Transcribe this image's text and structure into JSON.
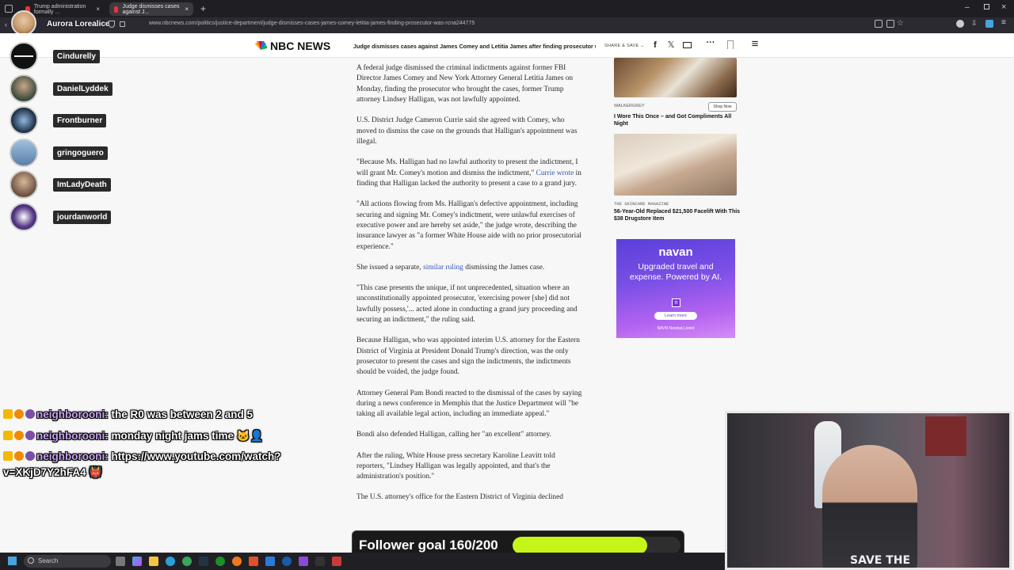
{
  "browser": {
    "tabs": [
      {
        "label": "Trump administration formally ...",
        "active": false
      },
      {
        "label": "Judge dismisses cases against J...",
        "active": true
      }
    ],
    "profile_name": "Aurora Lorealice",
    "url": "www.nbcnews.com/politics/justice-department/judge-dismisses-cases-james-comey-letitia-james-finding-prosecutor-was-rcna244775"
  },
  "site": {
    "brand": "NBC NEWS",
    "headline": "Judge dismisses cases against James Comey and Letitia James after finding prosecutor was un",
    "share_save": "SHARE & SAVE",
    "share_icons": [
      "facebook-icon",
      "x-icon",
      "mail-icon",
      "more-icon",
      "bookmark-icon",
      "menu-icon"
    ]
  },
  "article": {
    "p1": "A federal judge dismissed the criminal indictments against former FBI Director James Comey and New York Attorney General Letitia James on Monday, finding the prosecutor who brought the cases, former Trump attorney Lindsey Halligan, was not lawfully appointed.",
    "p2": "U.S. District Judge Cameron Currie said she agreed with Comey, who moved to dismiss the case on the grounds that Halligan's appointment was illegal.",
    "p3_before": "\"Because Ms. Halligan had no lawful authority to present the indictment, I will grant Mr. Comey's motion and dismiss the indictment,\" ",
    "p3_link": "Currie wrote",
    "p3_after": " in finding that Halligan lacked the authority to present a case to a grand jury.",
    "p4": "\"All actions flowing from Ms. Halligan's defective appointment, including securing and signing Mr. Comey's indictment, were unlawful exercises of executive power and are hereby set aside,\" the judge wrote, describing the insurance lawyer as \"a former White House aide with no prior prosecutorial experience.\"",
    "p5_before": "She issued a separate, ",
    "p5_link": "similar ruling",
    "p5_after": " dismissing the James case.",
    "p6": "\"This case presents the unique, if not unprecedented, situation where an unconstitutionally appointed prosecutor, 'exercising power [she] did not lawfully possess,'... acted alone in conducting a grand jury proceeding and securing an indictment,\" the ruling said.",
    "p7": "Because Halligan, who was appointed interim U.S. attorney for the Eastern District of Virginia at President Donald Trump's direction, was the only prosecutor to present the cases and sign the indictments, the indictments should be voided, the judge found.",
    "p8": "Attorney General Pam Bondi reacted to the dismissal of the cases by saying during a news conference in Memphis that the Justice Department will \"be taking all available legal action, including an immediate appeal.\"",
    "p9": "Bondi also defended Halligan, calling her \"an excellent\" attorney.",
    "p10": "After the ruling, White House press secretary Karoline Leavitt told reporters, \"Lindsey Halligan was legally appointed, and that's the administration's position.\"",
    "p11": "The U.S. attorney's office for the Eastern District of Virginia declined"
  },
  "ads": {
    "ad1": {
      "source": "WALKERGREY",
      "cta": "Shop Now",
      "title": "I Wore This Once – and Got Compliments All Night"
    },
    "ad2": {
      "source": "THE SKINCARE MAGAZINE",
      "title": "56-Year-Old Replaced $21,500 Facelift With This $38 Drugstore Item"
    },
    "navan": {
      "brand": "navan",
      "copy": "Upgraded travel and expense. Powered by AI.",
      "button": "Learn more",
      "footer": "NAVN  Nasdaq Listed",
      "color": "#6a45e0"
    }
  },
  "viewers": [
    {
      "name": "Cindurelly",
      "color": "#111111"
    },
    {
      "name": "DanielLyddek",
      "color": "#3b4a3a"
    },
    {
      "name": "Frontburner",
      "color": "#1b2a3e"
    },
    {
      "name": "gringoguero",
      "color": "#5a7fa6"
    },
    {
      "name": "ImLadyDeath",
      "color": "#6b5040"
    },
    {
      "name": "jourdanworld",
      "color": "#5a3a8a"
    }
  ],
  "chat": [
    {
      "user": "neighborooni:",
      "message": " the R0 was between 2 and 5"
    },
    {
      "user": "neighborooni:",
      "message": " monday night jams time 🐱‍👤"
    },
    {
      "user": "neighborooni:",
      "message": " https://www.youtube.com/watch?"
    },
    {
      "user": "",
      "message": "v=XKjD7Y2hFA4 👹"
    }
  ],
  "webcam": {
    "shirt_text": "SAVE THE"
  },
  "goal": {
    "label": "Follower goal 160/200",
    "current": 160,
    "target": 200,
    "color": "#c6f51a"
  },
  "taskbar": {
    "search_placeholder": "Search"
  }
}
